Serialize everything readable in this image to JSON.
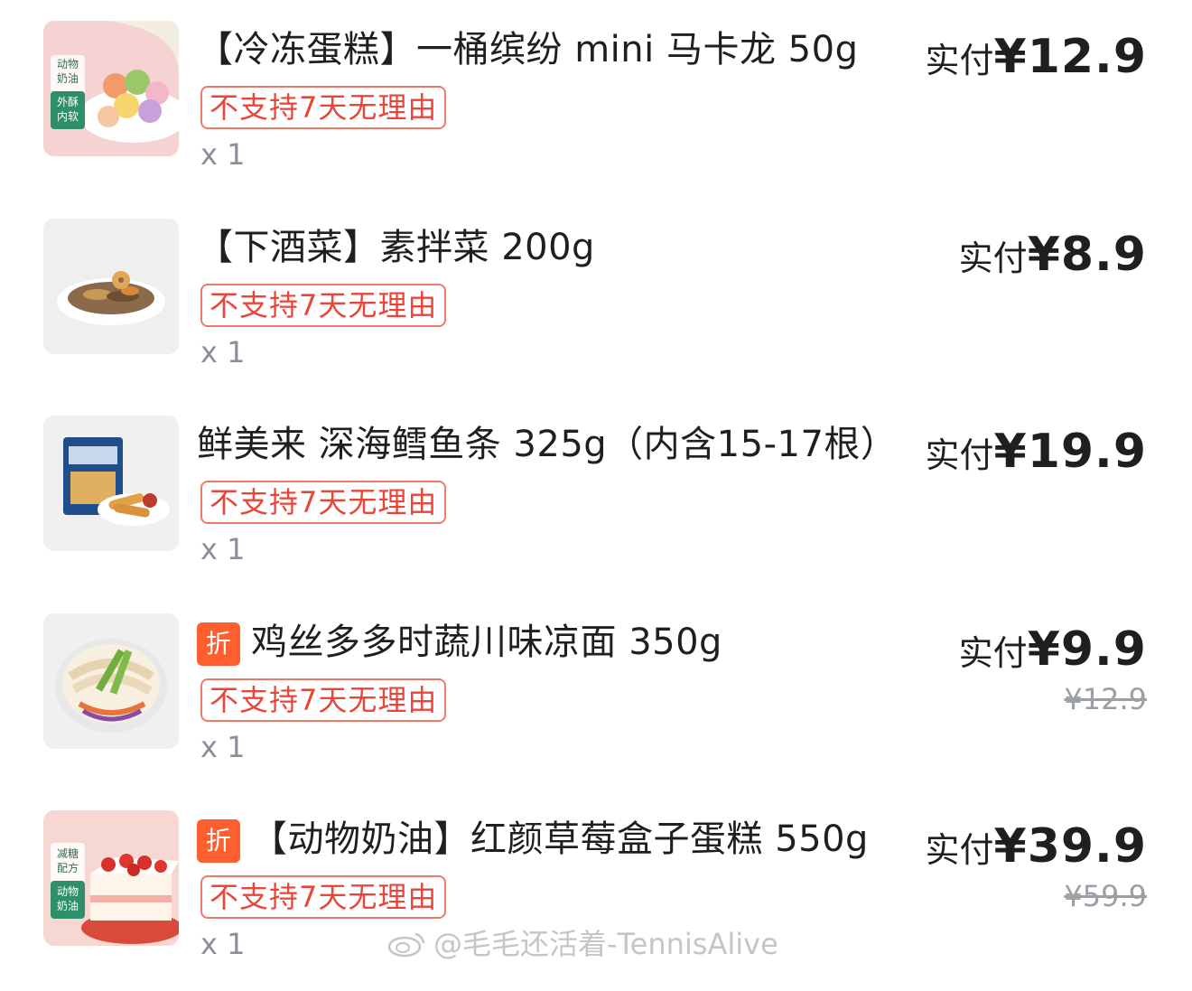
{
  "items": [
    {
      "discount_tag": "",
      "title": "【冷冻蛋糕】一桶缤纷 mini 马卡龙 50g",
      "policy": "不支持7天无理由",
      "qty": "x 1",
      "pay_label": "实付",
      "price": "¥12.9",
      "original_price": "",
      "thumb_lines": [
        "动物",
        "奶油",
        "外酥",
        "内软"
      ]
    },
    {
      "discount_tag": "",
      "title": "【下酒菜】素拌菜 200g",
      "policy": "不支持7天无理由",
      "qty": "x 1",
      "pay_label": "实付",
      "price": "¥8.9",
      "original_price": ""
    },
    {
      "discount_tag": "",
      "title": "鲜美来 深海鳕鱼条 325g（内含15-17根）",
      "policy": "不支持7天无理由",
      "qty": "x 1",
      "pay_label": "实付",
      "price": "¥19.9",
      "original_price": ""
    },
    {
      "discount_tag": "折",
      "title": "鸡丝多多时蔬川味凉面 350g",
      "policy": "不支持7天无理由",
      "qty": "x 1",
      "pay_label": "实付",
      "price": "¥9.9",
      "original_price": "¥12.9"
    },
    {
      "discount_tag": "折",
      "title": "【动物奶油】红颜草莓盒子蛋糕 550g",
      "policy": "不支持7天无理由",
      "qty": "x 1",
      "pay_label": "实付",
      "price": "¥39.9",
      "original_price": "¥59.9",
      "thumb_lines": [
        "减糖",
        "配方",
        "动物",
        "奶油"
      ]
    }
  ],
  "watermark": "@毛毛还活着-TennisAlive",
  "colors": {
    "policy_border": "#f07a6a",
    "policy_text": "#e8463a",
    "discount_tag": "#ff5f2e",
    "qty_text": "#8a8f99",
    "original_price": "#9aa0a6"
  }
}
